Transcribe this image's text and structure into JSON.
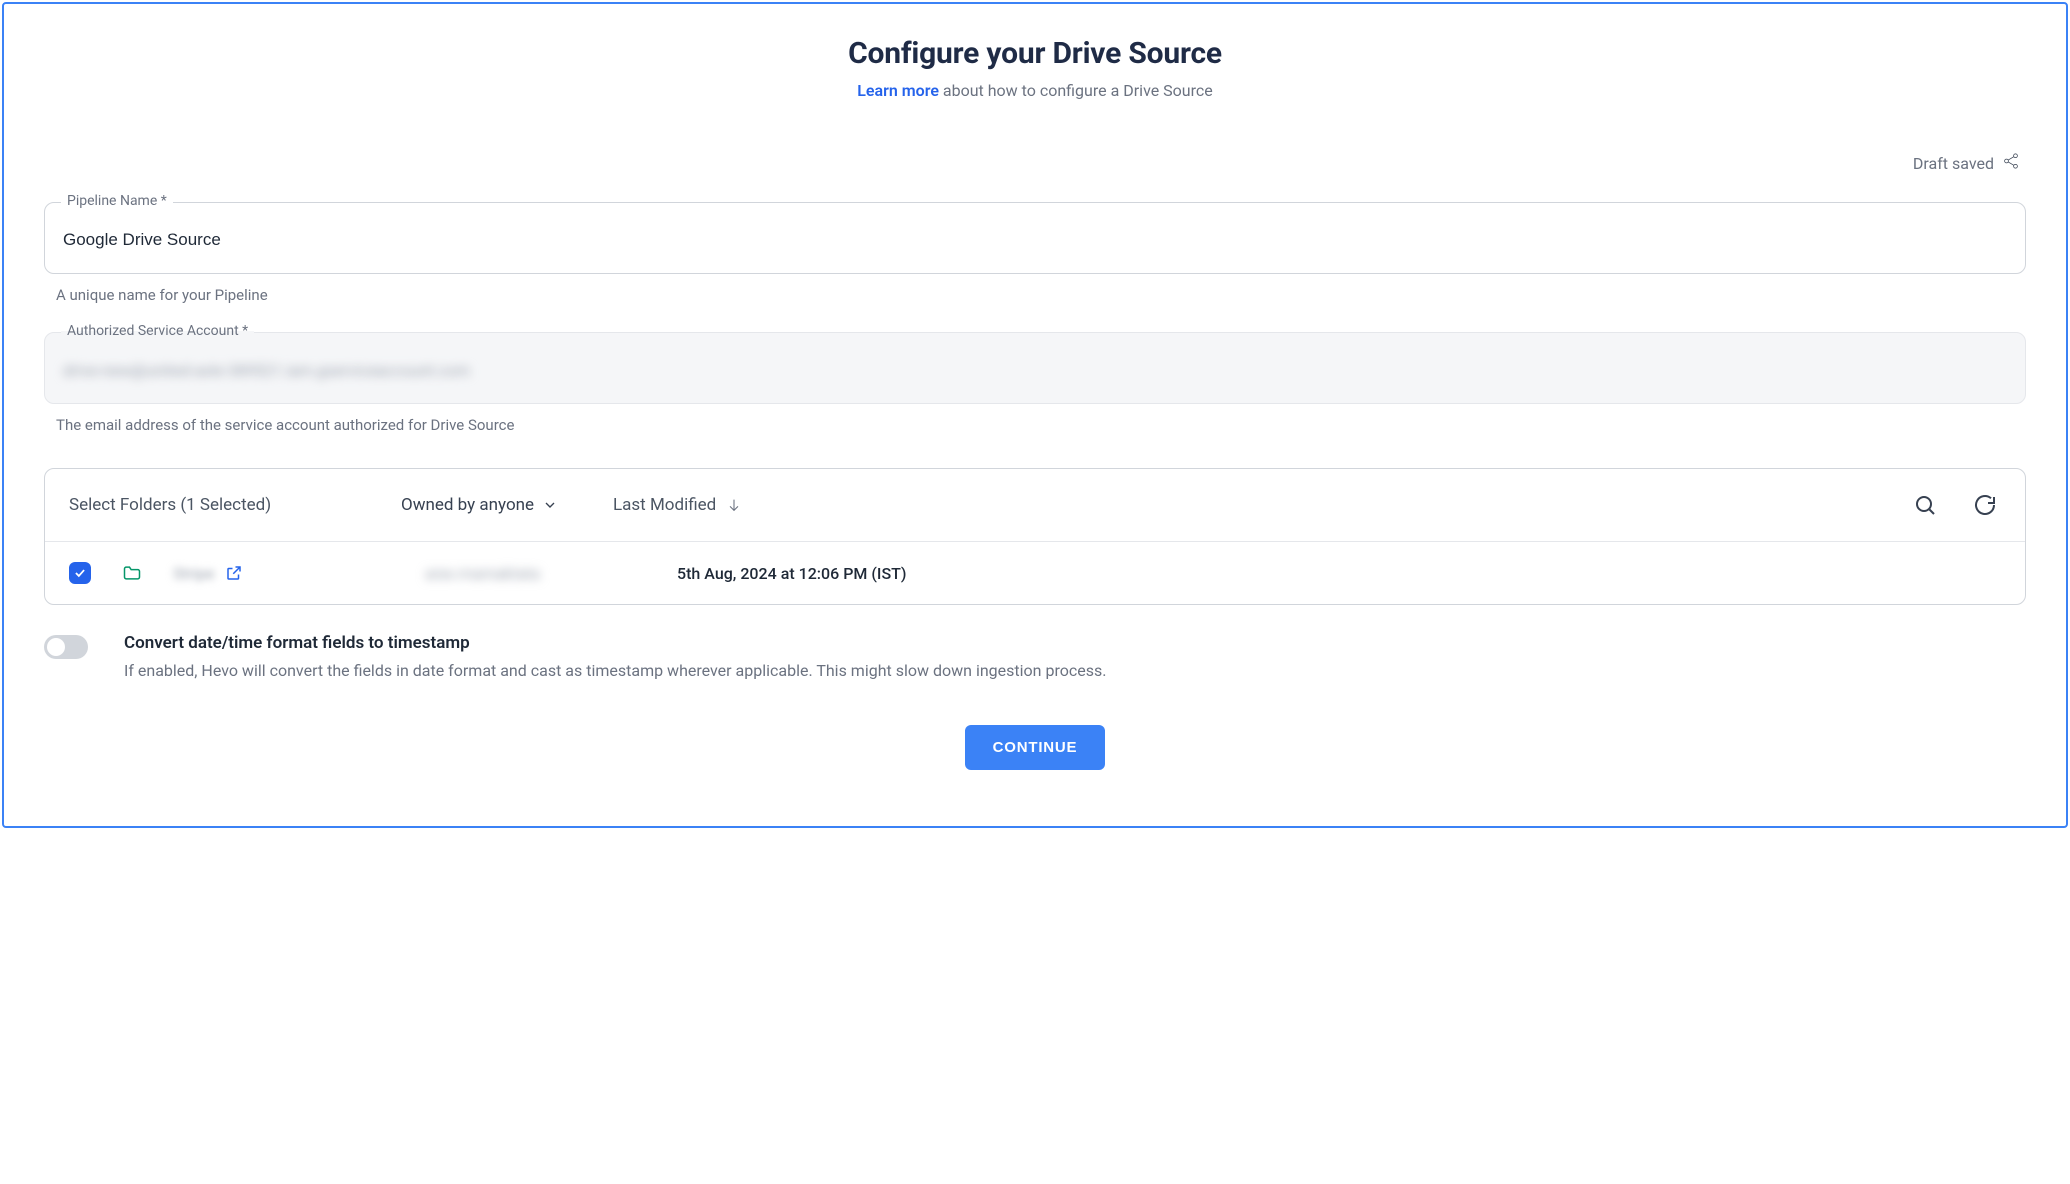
{
  "header": {
    "title": "Configure your Drive Source",
    "learn_more": "Learn more",
    "subtitle_rest": " about how to configure a Drive Source"
  },
  "draft_status": "Draft saved",
  "pipeline": {
    "label": "Pipeline Name *",
    "value": "Google Drive Source",
    "helper": "A unique name for your Pipeline"
  },
  "service_account": {
    "label": "Authorized Service Account *",
    "value_obscured": "drive-new@united-axle-389521.iam.gserviceaccount.com",
    "helper": "The email address of the service account authorized for Drive Source"
  },
  "folders": {
    "header_label": "Select Folders (1 Selected)",
    "filter_label": "Owned by anyone",
    "sort_label": "Last Modified",
    "rows": [
      {
        "checked": true,
        "name_obscured": "Stripe",
        "owner_obscured": "arav.mamaktata",
        "modified": "5th Aug, 2024 at 12:06 PM (IST)"
      }
    ]
  },
  "toggle": {
    "title": "Convert date/time format fields to timestamp",
    "desc": "If enabled, Hevo will convert the fields in date format and cast as timestamp wherever applicable. This might slow down ingestion process."
  },
  "continue_label": "CONTINUE"
}
